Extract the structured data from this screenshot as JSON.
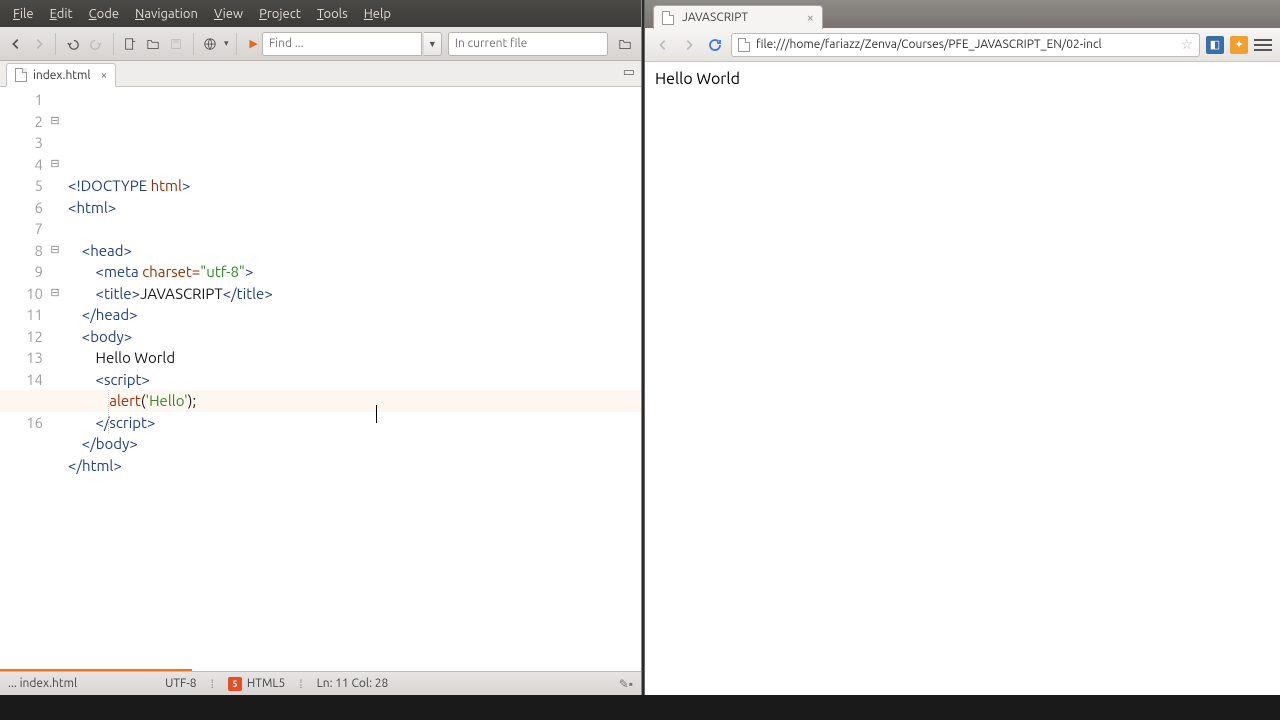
{
  "menus": [
    "File",
    "Edit",
    "Code",
    "Navigation",
    "View",
    "Project",
    "Tools",
    "Help"
  ],
  "menu_accel": [
    0,
    0,
    0,
    0,
    0,
    0,
    0,
    0
  ],
  "find": {
    "placeholder": "Find ...",
    "scope_placeholder": "In current file"
  },
  "tab": {
    "name": "index.html"
  },
  "code": {
    "lines": 16,
    "fold_rows": [
      2,
      4,
      8,
      10
    ],
    "hl_row": 11,
    "rows": [
      [
        [
          "<!DOCTYPE ",
          "blue"
        ],
        [
          "html",
          "brown"
        ],
        [
          ">",
          "blue"
        ]
      ],
      [
        [
          "<html>",
          "blue"
        ]
      ],
      [
        [
          "",
          ""
        ]
      ],
      [
        [
          "    ",
          ""
        ],
        [
          "<head>",
          "blue"
        ]
      ],
      [
        [
          "        ",
          ""
        ],
        [
          "<meta ",
          "blue"
        ],
        [
          "charset=",
          "brown"
        ],
        [
          "\"utf-8\"",
          "green"
        ],
        [
          ">",
          "blue"
        ]
      ],
      [
        [
          "        ",
          ""
        ],
        [
          "<title>",
          "blue"
        ],
        [
          "JAVASCRIPT",
          "black"
        ],
        [
          "</title>",
          "blue"
        ]
      ],
      [
        [
          "    ",
          ""
        ],
        [
          "</head>",
          "blue"
        ]
      ],
      [
        [
          "    ",
          ""
        ],
        [
          "<body>",
          "blue"
        ]
      ],
      [
        [
          "        ",
          ""
        ],
        [
          "Hello World",
          "black"
        ]
      ],
      [
        [
          "        ",
          ""
        ],
        [
          "<script>",
          "blue"
        ]
      ],
      [
        [
          "            ",
          ""
        ],
        [
          "alert",
          "brown"
        ],
        [
          "(",
          "black"
        ],
        [
          "'Hello'",
          "green"
        ],
        [
          ");",
          "black"
        ]
      ],
      [
        [
          "        ",
          ""
        ],
        [
          "</script>",
          "blue"
        ]
      ],
      [
        [
          "    ",
          ""
        ],
        [
          "</body>",
          "blue"
        ]
      ],
      [
        [
          "</html>",
          "blue"
        ]
      ],
      [
        [
          "",
          ""
        ]
      ],
      [
        [
          "",
          ""
        ]
      ]
    ]
  },
  "status": {
    "file": "... index.html",
    "encoding": "UTF-8",
    "syntax": "HTML5",
    "cursor": "Ln: 11 Col: 28"
  },
  "browser": {
    "tab_title": "JAVASCRIPT",
    "url": "file:///home/fariazz/Zenva/Courses/PFE_JAVASCRIPT_EN/02-incl",
    "body_text": "Hello World"
  }
}
